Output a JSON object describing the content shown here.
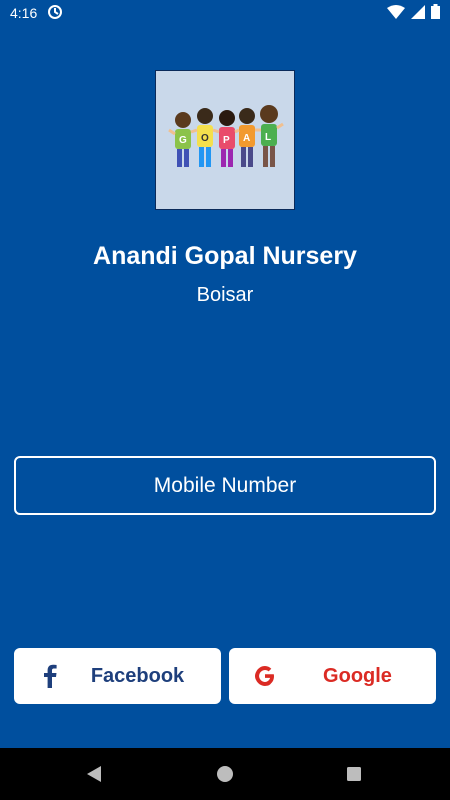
{
  "status_bar": {
    "time": "4:16"
  },
  "header": {
    "title": "Anandi Gopal Nursery",
    "subtitle": "Boisar",
    "logo_text": "GOPAL"
  },
  "actions": {
    "mobile_label": "Mobile Number",
    "facebook_label": "Facebook",
    "google_label": "Google"
  },
  "icons": {
    "facebook": "facebook-icon",
    "google": "google-icon",
    "back": "back-icon",
    "home": "home-icon",
    "recents": "recents-icon"
  },
  "colors": {
    "background": "#004f9e",
    "facebook_text": "#1e3f7c",
    "google_text": "#db2b24",
    "button_bg": "#ffffff"
  }
}
